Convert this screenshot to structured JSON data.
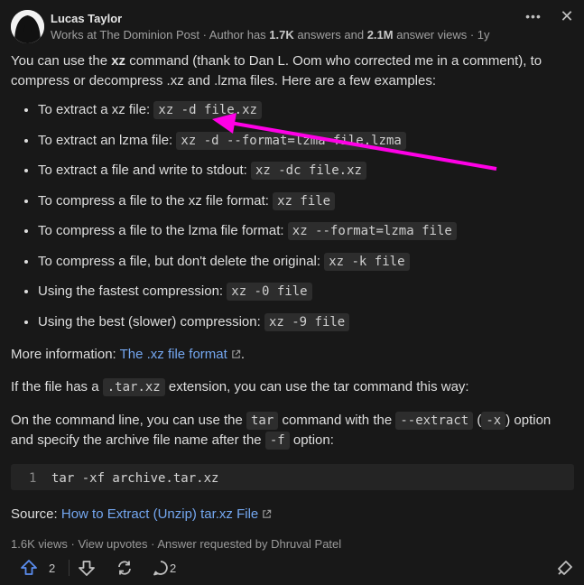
{
  "author": {
    "name": "Lucas Taylor",
    "credential_prefix": "Works at The Dominion Post · Author has ",
    "answers_count": "1.7K",
    "answers_word": " answers and ",
    "views_count": "2.1M",
    "views_suffix": " answer views · 1y"
  },
  "header": {
    "more_label": "•••",
    "close_label": "✕"
  },
  "intro": {
    "part1": "You can use the ",
    "cmd": "xz",
    "part2": " command (thank to Dan L. Oom who corrected me in a comment), to compress or decompress .xz and .lzma files. Here are a few examples:"
  },
  "examples": [
    {
      "label": "To extract a xz file: ",
      "code": "xz -d file.xz"
    },
    {
      "label": "To extract an lzma file: ",
      "code": "xz -d --format=lzma file.lzma"
    },
    {
      "label": "To extract a file and write to stdout: ",
      "code": "xz -dc file.xz"
    },
    {
      "label": "To compress a file to the xz file format: ",
      "code": "xz file"
    },
    {
      "label": "To compress a file to the lzma file format: ",
      "code": "xz --format=lzma file"
    },
    {
      "label": "To compress a file, but don't delete the original: ",
      "code": "xz -k file"
    },
    {
      "label": "Using the fastest compression: ",
      "code": "xz -0 file"
    },
    {
      "label": "Using the best (slower) compression: ",
      "code": "xz -9 file"
    }
  ],
  "more_info": {
    "label": "More information: ",
    "link": "The .xz file format",
    "end": "."
  },
  "tar_para": {
    "part1": "If the file has a ",
    "code": ".tar.xz",
    "part2": " extension, you can use the tar command this way:"
  },
  "cmd_para": {
    "part1": "On the command line, you can use the ",
    "code1": "tar",
    "part2": " command with the ",
    "code2": "--extract",
    "part3": " (",
    "code3": "-x",
    "part4": ") option and specify the archive file name after the ",
    "code4": "-f",
    "part5": " option:"
  },
  "code_block": {
    "line_number": "1",
    "code": "tar -xf archive.tar.xz"
  },
  "source": {
    "label": "Source: ",
    "link": "How to Extract (Unzip) tar.xz File"
  },
  "stats": {
    "views": "1.6K views",
    "sep": " · ",
    "upvotes": "View upvotes",
    "requested": "Answer requested by Dhruval Patel"
  },
  "actions": {
    "upvote_count": "2",
    "comment_count": "2"
  },
  "colors": {
    "background": "#181818",
    "link": "#74a7f0",
    "upvote": "#5b8def",
    "arrow": "#ff00e6"
  },
  "icons": [
    "more-icon",
    "close-icon",
    "external-link-icon",
    "upvote-icon",
    "downvote-icon",
    "share-icon",
    "comment-icon",
    "repost-icon"
  ]
}
